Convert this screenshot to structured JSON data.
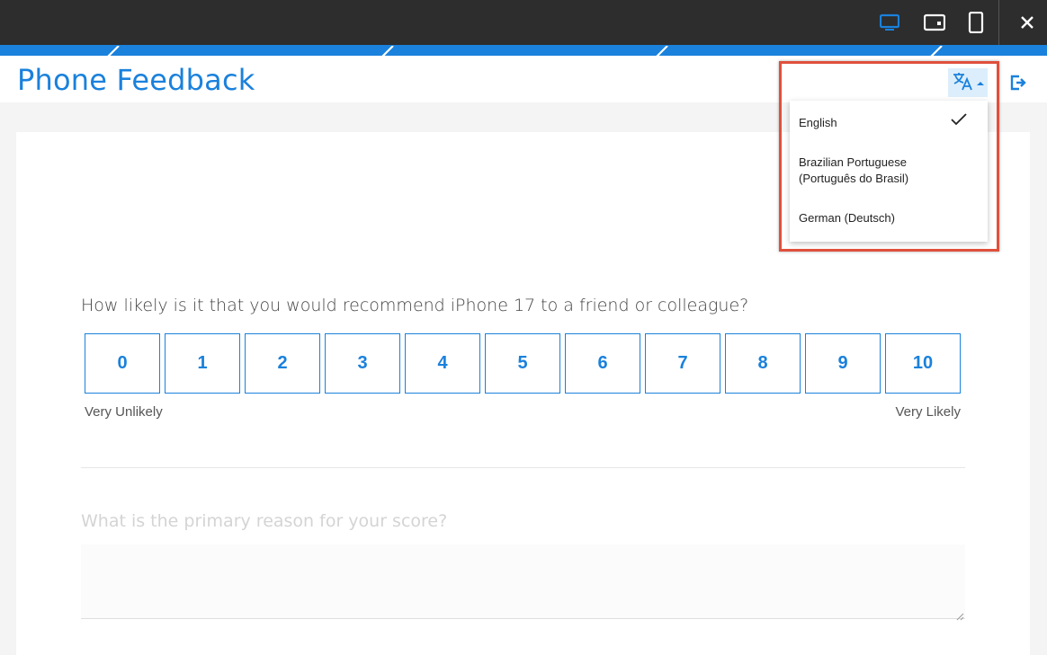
{
  "app": {
    "title": "Phone Feedback"
  },
  "colors": {
    "brand": "#1a81dc",
    "topbar": "#2d2d2d",
    "highlight": "#e0503c"
  },
  "topbar": {
    "icons": [
      "desktop-view-icon",
      "tablet-view-icon",
      "mobile-view-icon",
      "close-icon"
    ],
    "active_view": "desktop"
  },
  "language_menu": {
    "icon": "translate-icon",
    "items": [
      {
        "label": "English",
        "selected": true
      },
      {
        "label": "Brazilian Portuguese\n(Português do Brasil)",
        "line1": "Brazilian Portuguese",
        "line2": "(Português do Brasil)",
        "selected": false
      },
      {
        "label": "German (Deutsch)",
        "selected": false
      }
    ]
  },
  "survey": {
    "nps_question": "How likely is it that you would recommend iPhone 17 to a friend or colleague?",
    "scale": [
      "0",
      "1",
      "2",
      "3",
      "4",
      "5",
      "6",
      "7",
      "8",
      "9",
      "10"
    ],
    "low_label": "Very Unlikely",
    "high_label": "Very Likely",
    "reason_question": "What is the primary reason for your score?"
  }
}
